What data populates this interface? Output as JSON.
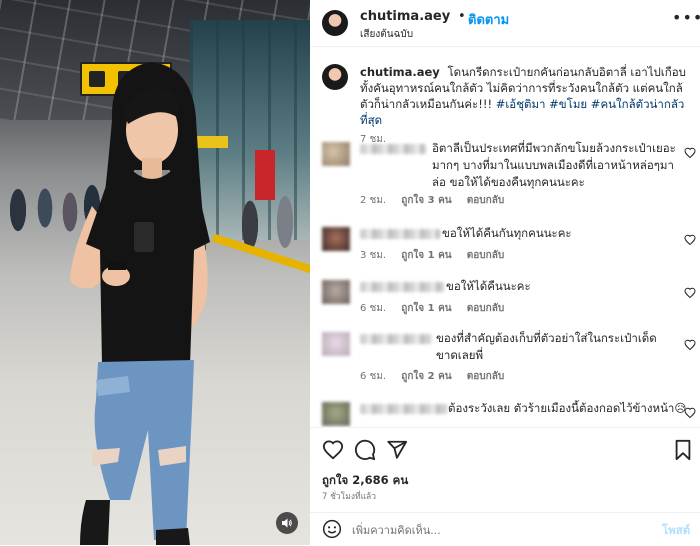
{
  "header": {
    "username": "chutima.aey",
    "separator": "•",
    "follow_label": "ติดตาม",
    "audio_label": "เสียงต้นฉบับ",
    "more_label": "•••"
  },
  "caption": {
    "username": "chutima.aey",
    "text": "โดนกรีดกระเป๋ายกคันก่อนกลับอิตาลี่ เอาไปเกือบทั้งคันอุทาหรณ์คนใกล้ตัว ไม่คิดว่าการที่ระวังคนใกล้ตัว แต่คนใกล้ตัวก็น่ากลัวเหมือนกันค่ะ!!! ",
    "hashtags": "#เอ้ชุติมา #ขโมย #คนใกล้ตัวน่ากลัวที่สุด",
    "time": "7 ชม."
  },
  "comments": [
    {
      "text": "อิตาลีเป็นประเทศที่มีพวกลักขโมยล้วงกระเป๋าเยอะมากๆ บางที่มาในแบบพลเมืองดีที่เอาหน้าหล่อๆมาล่อ ขอให้ได้ของคืนทุกคนนะคะ",
      "time": "2 ชม.",
      "likes": "ถูกใจ 3 คน",
      "reply": "ตอบกลับ"
    },
    {
      "text": "ขอให้ได้คืนกันทุกคนนะคะ",
      "time": "3 ชม.",
      "likes": "ถูกใจ 1 คน",
      "reply": "ตอบกลับ"
    },
    {
      "text": "ขอให้ได้คืนนะคะ",
      "time": "6 ชม.",
      "likes": "ถูกใจ 1 คน",
      "reply": "ตอบกลับ"
    },
    {
      "text": "ของที่สำคัญต้องเก็บที่ตัวอย่าใส่ในกระเป๋าเด็ดขาดเลยพี่",
      "time": "6 ชม.",
      "likes": "ถูกใจ 2 คน",
      "reply": "ตอบกลับ"
    },
    {
      "text": "ต้องระวังเลย ตัวร้ายเมืองนี้ต้องกอดไว้ข้างหน้า😥",
      "time": "",
      "likes": "",
      "reply": ""
    }
  ],
  "actions": {
    "likes_count": "ถูกใจ 2,686 คน",
    "post_time": "7 ชั่วโมงที่แล้ว",
    "icons": [
      "heart-icon",
      "comment-icon",
      "share-icon",
      "bookmark-icon"
    ]
  },
  "add_comment": {
    "placeholder": "เพิ่มความคิดเห็น...",
    "post_label": "โพสต์"
  },
  "colors": {
    "link_blue": "#0095f6",
    "post_disabled": "#b2dffc",
    "secondary_text": "#737373",
    "hashtag": "#00376b"
  }
}
